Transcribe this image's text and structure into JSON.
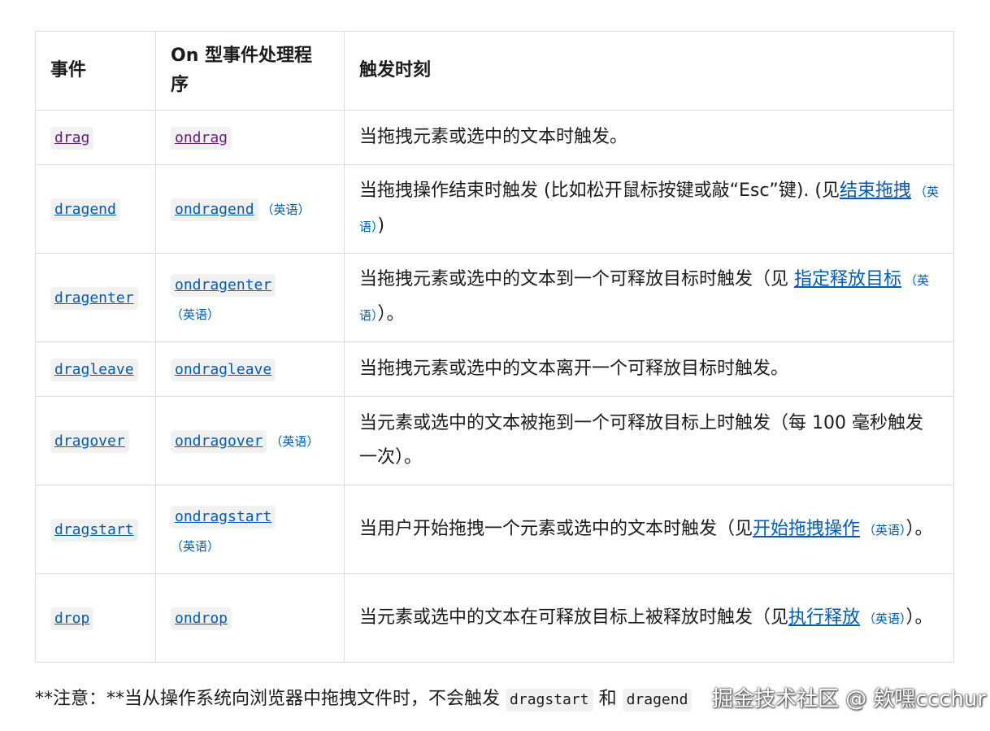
{
  "table": {
    "headers": [
      "事件",
      "On 型事件处理程序",
      "触发时刻"
    ],
    "lang_label": "（英语）",
    "rows": [
      {
        "event": "drag",
        "handler": "ondrag",
        "desc_pre": "当拖拽元素或选中的文本时触发。"
      },
      {
        "event": "dragend",
        "handler": "ondragend",
        "desc_pre": "当拖拽操作结束时触发 (比如松开鼠标按键或敲“Esc”键). (见",
        "desc_link": "结束拖拽",
        "desc_post": ")"
      },
      {
        "event": "dragenter",
        "handler": "ondragenter",
        "desc_pre": "当拖拽元素或选中的文本到一个可释放目标时触发（见 ",
        "desc_link": "指定释放目标",
        "desc_post": "）。"
      },
      {
        "event": "dragleave",
        "handler": "ondragleave",
        "desc_pre": "当拖拽元素或选中的文本离开一个可释放目标时触发。"
      },
      {
        "event": "dragover",
        "handler": "ondragover",
        "desc_pre": "当元素或选中的文本被拖到一个可释放目标上时触发（每 100 毫秒触发一次）。"
      },
      {
        "event": "dragstart",
        "handler": "ondragstart",
        "desc_pre": "当用户开始拖拽一个元素或选中的文本时触发（见",
        "desc_link": "开始拖拽操作",
        "desc_post": "）。"
      },
      {
        "event": "drop",
        "handler": "ondrop",
        "desc_pre": "当元素或选中的文本在可释放目标上被释放时触发（见",
        "desc_link": "执行释放",
        "desc_post": "）。"
      }
    ]
  },
  "note": {
    "prefix": "**注意：**当从操作系统向浏览器中拖拽文件时，不会触发",
    "code1": "dragstart",
    "middle": "和",
    "code2": "dragend"
  },
  "watermark": "掘金技术社区 @ 欸嘿ccchur",
  "colors": {
    "link": "#005cb6",
    "visited": "#6a1b84",
    "border": "#dcdcdc",
    "code_bg": "#f2f1f1"
  }
}
